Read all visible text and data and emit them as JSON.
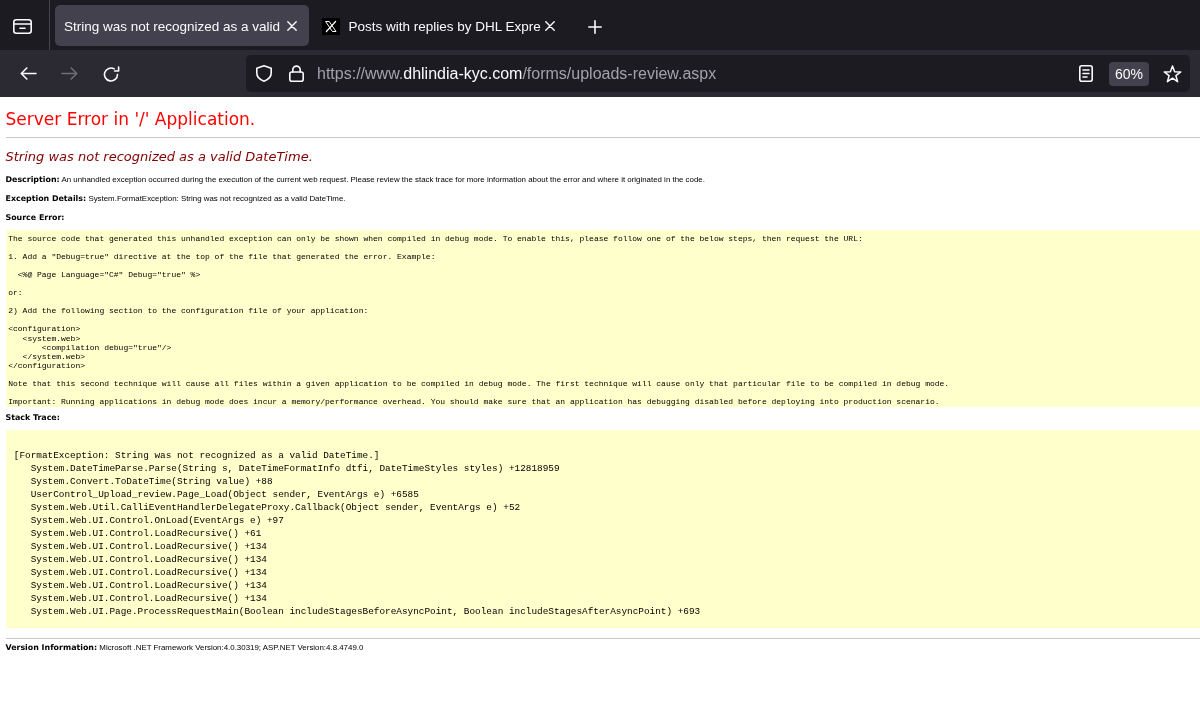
{
  "browser": {
    "tabs": [
      {
        "title": "String was not recognized as a valid",
        "selected": true,
        "favicon": false
      },
      {
        "title": "Posts with replies by DHL Expre",
        "selected": false,
        "favicon": true
      }
    ],
    "nav_buttons": [
      {
        "kind": "back",
        "disabled": false
      },
      {
        "kind": "forward",
        "disabled": true
      },
      {
        "kind": "reload",
        "disabled": false
      }
    ],
    "address_bar": {
      "url": {
        "prefix": "https://www.",
        "domain": "dhlindia-kyc.com",
        "path": "/forms/uploads-review.aspx"
      },
      "zoom": "60%"
    }
  },
  "page": {
    "title": "Server Error in '/' Application.",
    "error_message": "String was not recognized as a valid DateTime.",
    "details": [
      "**Description:** An unhandled exception occurred during the execution of the current web request. Please review the stack trace for more information about the error and where it originated in the code.",
      "**Exception Details:** System.FormatException: String was not recognized as a valid DateTime."
    ],
    "source_error": {
      "heading": "Source Error:",
      "paragraphs": [
        [
          "The source code that generated this unhandled exception can only be shown when compiled in debug mode. To enable this, please follow one of the below steps, then request the URL:"
        ],
        [
          "1. Add a \"Debug=true\" directive at the top of the file that generated the error. Example:"
        ],
        [
          "  <%@ Page Language=\"C#\" Debug=\"true\" %>"
        ],
        [
          "or:"
        ],
        [
          "2) Add the following section to the configuration file of your application:"
        ],
        [
          "<configuration>",
          "   <system.web>",
          "       <compilation debug=\"true\"/>",
          "   </system.web>",
          "</configuration>"
        ],
        [
          "Note that this second technique will cause all files within a given application to be compiled in debug mode. The first technique will cause only that particular file to be compiled in debug mode."
        ],
        [
          "Important: Running applications in debug mode does incur a memory/performance overhead. You should make sure that an application has debugging disabled before deploying into production scenario."
        ]
      ]
    },
    "stack_trace": {
      "heading": "Stack Trace:",
      "lines": [
        "[FormatException: String was not recognized as a valid DateTime.]",
        "   System.DateTimeParse.Parse(String s, DateTimeFormatInfo dtfi, DateTimeStyles styles) +12818959",
        "   System.Convert.ToDateTime(String value) +88",
        "   UserControl_Upload_review.Page_Load(Object sender, EventArgs e) +6585",
        "   System.Web.Util.CalliEventHandlerDelegateProxy.Callback(Object sender, EventArgs e) +52",
        "   System.Web.UI.Control.OnLoad(EventArgs e) +97",
        "   System.Web.UI.Control.LoadRecursive() +61",
        "   System.Web.UI.Control.LoadRecursive() +134",
        "   System.Web.UI.Control.LoadRecursive() +134",
        "   System.Web.UI.Control.LoadRecursive() +134",
        "   System.Web.UI.Control.LoadRecursive() +134",
        "   System.Web.UI.Control.LoadRecursive() +134",
        "   System.Web.UI.Page.ProcessRequestMain(Boolean includeStagesBeforeAsyncPoint, Boolean includeStagesAfterAsyncPoint) +693"
      ]
    },
    "version_info": "**Version Information:** Microsoft .NET Framework Version:4.0.30319; ASP.NET Version:4.8.4749.0"
  }
}
